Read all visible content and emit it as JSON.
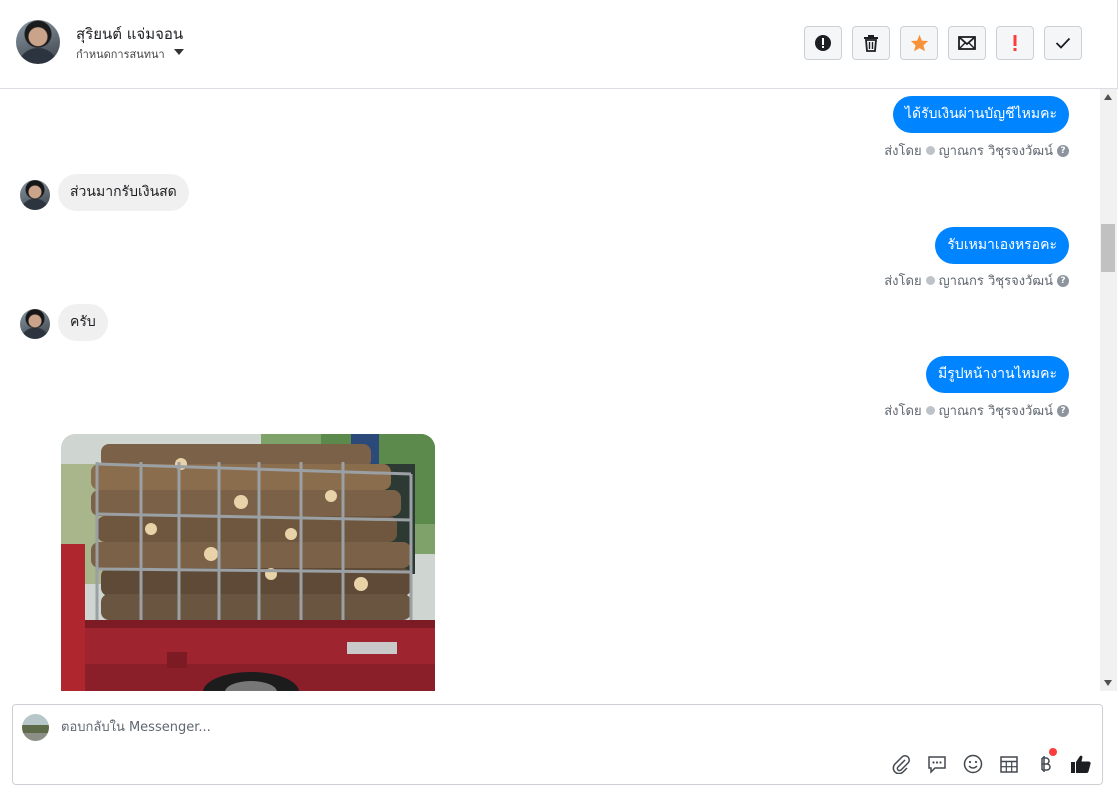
{
  "header": {
    "contact_name": "สุริยนต์ แจ่มจอน",
    "conversation_settings_label": "กำหนดการสนทนา",
    "actions": [
      {
        "name": "report-spam-button",
        "icon": "exclamation-circle-icon"
      },
      {
        "name": "delete-button",
        "icon": "trash-icon"
      },
      {
        "name": "star-button",
        "icon": "star-icon",
        "color": "#f7923b"
      },
      {
        "name": "mark-unread-button",
        "icon": "envelope-icon"
      },
      {
        "name": "follow-up-button",
        "icon": "exclamation-icon",
        "color": "#fa3e3e"
      },
      {
        "name": "mark-done-button",
        "icon": "checkmark-icon"
      }
    ]
  },
  "messages": [
    {
      "direction": "out",
      "text": "ได้รับเงินผ่านบัญชีไหมคะ",
      "sent_by_label": "ส่งโดย",
      "sender": "ญาณกร วิชุรจงวัฒน์"
    },
    {
      "direction": "in",
      "text": "ส่วนมากรับเงินสด"
    },
    {
      "direction": "out",
      "text": "รับเหมาเองหรอคะ",
      "sent_by_label": "ส่งโดย",
      "sender": "ญาณกร วิชุรจงวัฒน์"
    },
    {
      "direction": "in",
      "text": "ครับ"
    },
    {
      "direction": "out",
      "text": "มีรูปหน้างานไหมคะ",
      "sent_by_label": "ส่งโดย",
      "sender": "ญาณกร วิชุรจงวัฒน์"
    },
    {
      "direction": "in",
      "type": "image",
      "description": "pickup-truck-loaded-with-logs"
    }
  ],
  "composer": {
    "placeholder": "ตอบกลับใน Messenger...",
    "tools": [
      "paperclip-icon",
      "saved-replies-icon",
      "emoji-icon",
      "appointment-icon",
      "payment-baht-icon",
      "thumbs-up-icon"
    ]
  },
  "colors": {
    "accent": "#0084ff",
    "incoming_bubble": "#f0f0f0",
    "badge": "#fa3e3e"
  }
}
